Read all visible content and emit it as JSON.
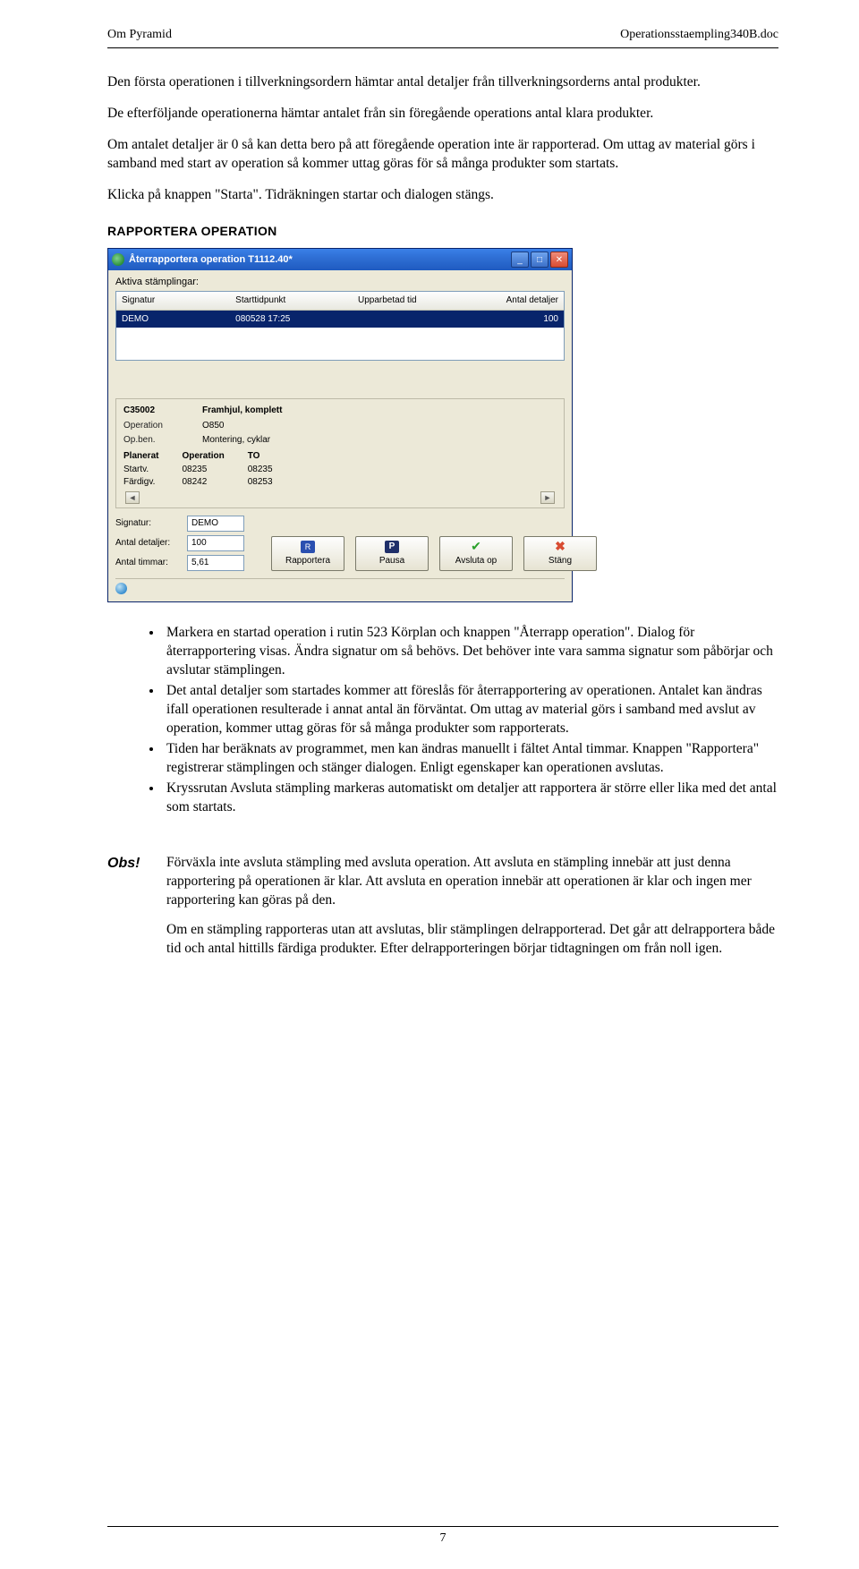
{
  "header": {
    "left": "Om Pyramid",
    "right": "Operationsstaempling340B.doc"
  },
  "paras": {
    "p1": "Den första operationen i tillverkningsordern hämtar antal detaljer från tillverkningsorderns antal produkter.",
    "p2": "De efterföljande operationerna hämtar antalet från sin föregående operations antal klara produkter.",
    "p3": "Om antalet detaljer är 0 så kan detta bero på att föregående operation inte är rapporterad. Om uttag av material görs i samband med start av operation så kommer uttag göras för så många produkter som startats.",
    "p4": "Klicka på knappen \"Starta\". Tidräkningen startar och dialogen stängs."
  },
  "section_title": "RAPPORTERA OPERATION",
  "window": {
    "title": "Återrapportera operation T1112.40*",
    "aktiva_label": "Aktiva stämplingar:",
    "grid_head": {
      "c1": "Signatur",
      "c2": "Starttidpunkt",
      "c3": "Upparbetad tid",
      "c4": "Antal detaljer"
    },
    "grid_row": {
      "c1": "DEMO",
      "c2": "080528 17:25",
      "c3": "",
      "c4": "100"
    },
    "mid": {
      "artno": "C35002",
      "artname": "Framhjul, komplett",
      "op_lbl": "Operation",
      "op_val": "O850",
      "opben_lbl": "Op.ben.",
      "opben_val": "Montering, cyklar",
      "plan_head": {
        "c0": "Planerat",
        "c1": "Operation",
        "c2": "TO"
      },
      "startv_lbl": "Startv.",
      "startv_op": "08235",
      "startv_to": "08235",
      "fardigv_lbl": "Färdigv.",
      "fardigv_op": "08242",
      "fardigv_to": "08253"
    },
    "fields": {
      "sig_lbl": "Signatur:",
      "sig_val": "DEMO",
      "det_lbl": "Antal detaljer:",
      "det_val": "100",
      "tim_lbl": "Antal timmar:",
      "tim_val": "5,61"
    },
    "buttons": {
      "rapportera": "Rapportera",
      "pausa": "Pausa",
      "avsluta": "Avsluta op",
      "stang": "Stäng"
    }
  },
  "bullets": [
    "Markera en startad operation i rutin 523 Körplan och knappen \"Återrapp operation\". Dialog för återrapportering visas. Ändra signatur om så behövs. Det behöver inte vara samma signatur som påbörjar och avslutar stämplingen.",
    "Det antal detaljer som startades kommer att föreslås för återrapportering av operationen. Antalet kan ändras ifall operationen resulterade i annat antal än förväntat. Om uttag av material görs i samband med avslut av operation, kommer uttag göras för så många produkter som rapporterats.",
    "Tiden har beräknats av programmet, men kan ändras manuellt i fältet Antal timmar. Knappen \"Rapportera\" registrerar stämplingen och stänger dialogen. Enligt egenskaper kan operationen avslutas.",
    "Kryssrutan Avsluta stämpling markeras automatiskt om detaljer att rapportera är större eller lika med det antal som startats."
  ],
  "obs": {
    "label": "Obs!",
    "p1": "Förväxla inte avsluta stämpling med avsluta operation. Att avsluta en stämpling innebär att just denna rapportering på operationen är klar. Att avsluta en operation innebär att operationen är klar och ingen mer rapportering kan göras på den.",
    "p2": "Om en stämpling rapporteras utan att avslutas, blir stämplingen delrapporterad. Det går att delrapportera både tid och antal hittills färdiga produkter. Efter delrapporteringen börjar tidtagningen om från noll igen."
  },
  "page_number": "7"
}
